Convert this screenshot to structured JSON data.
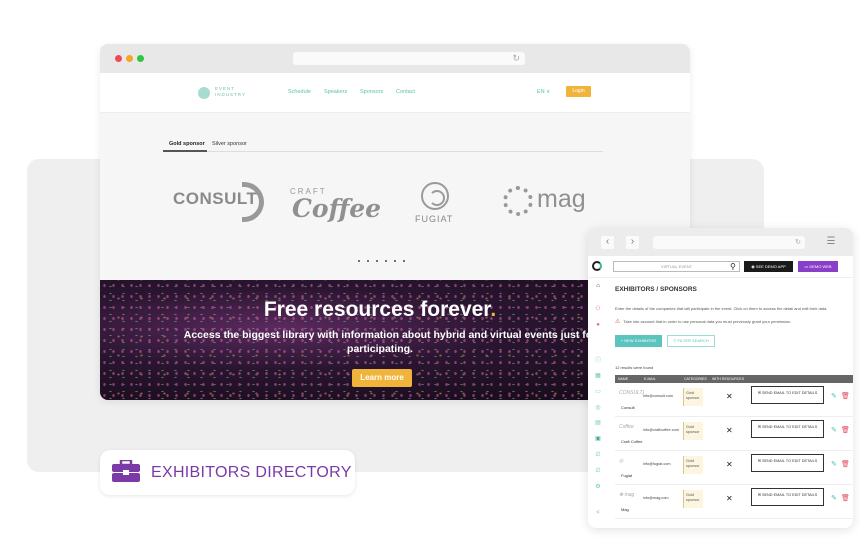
{
  "main_site": {
    "brand": {
      "line1": "EVENT",
      "line2": "INDUSTRY"
    },
    "nav": [
      "Schedule",
      "Speakers",
      "Sponsors",
      "Contact"
    ],
    "language": "EN ∨",
    "login_label": "Login",
    "sponsor_tabs": [
      {
        "label": "Gold sponsor",
        "active": true
      },
      {
        "label": "Silver sponsor",
        "active": false
      }
    ],
    "sponsors": {
      "consult": "CONSULT",
      "craft": "CRAFT",
      "coffee": "Coffee",
      "fugiat": "FUGIAT",
      "mag": "mag"
    },
    "hero": {
      "title": "Free resources forever",
      "title_dot": ".",
      "subtitle_line1": "Access the biggest library with information about hybrid and virtual events just for",
      "subtitle_line2": "participating.",
      "cta": "Learn more"
    }
  },
  "feature_label": "EXHIBITORS DIRECTORY",
  "admin_panel": {
    "search_placeholder": "VIRTUAL EVENT",
    "see_demo_app": "◉ SEE DEMO APP",
    "demo_web": "▭ DEMO WEB",
    "title": "EXHIBITORS / SPONSORS",
    "description": "Enter the details of the companies that will participate in the event. Click on them to access the detail and edit their data.",
    "warning": "Take into account that in order to use personal data you must previously grant your permission.",
    "new_exhibitor": "+ NEW EXHIBITOR",
    "filter_search": "▽ FILTER SEARCH",
    "results_count": "12 results were found",
    "columns": [
      "NAME",
      "E-MAIL",
      "CATEGORIES",
      "WITH RESOURCES"
    ],
    "rows": [
      {
        "logo": "CONSULT)",
        "name": "Consult",
        "email": "info@consult.com",
        "category": "Gold sponsor",
        "with_resources": "✕",
        "action": "✉ SEND EMAIL TO EDIT DETAILS"
      },
      {
        "logo": "Coffee",
        "name": "Craft Coffee",
        "email": "info@craftcoffee.com",
        "category": "Gold sponsor",
        "with_resources": "✕",
        "action": "✉ SEND EMAIL TO EDIT DETAILS"
      },
      {
        "logo": "◎",
        "name": "Fugiat",
        "email": "info@fugiat.com",
        "category": "Gold sponsor",
        "with_resources": "✕",
        "action": "✉ SEND EMAIL TO EDIT DETAILS"
      },
      {
        "logo": "❋ mag",
        "name": "Mag",
        "email": "info@mag.com",
        "category": "Gold sponsor",
        "with_resources": "✕",
        "action": "✉ SEND EMAIL TO EDIT DETAILS"
      }
    ]
  },
  "colors": {
    "brand_teal": "#5bbfa8",
    "accent_yellow": "#f0b43a",
    "purple": "#7b3aa6",
    "demo_web_purple": "#8a3fc8",
    "delete_red": "#e04a5a"
  }
}
